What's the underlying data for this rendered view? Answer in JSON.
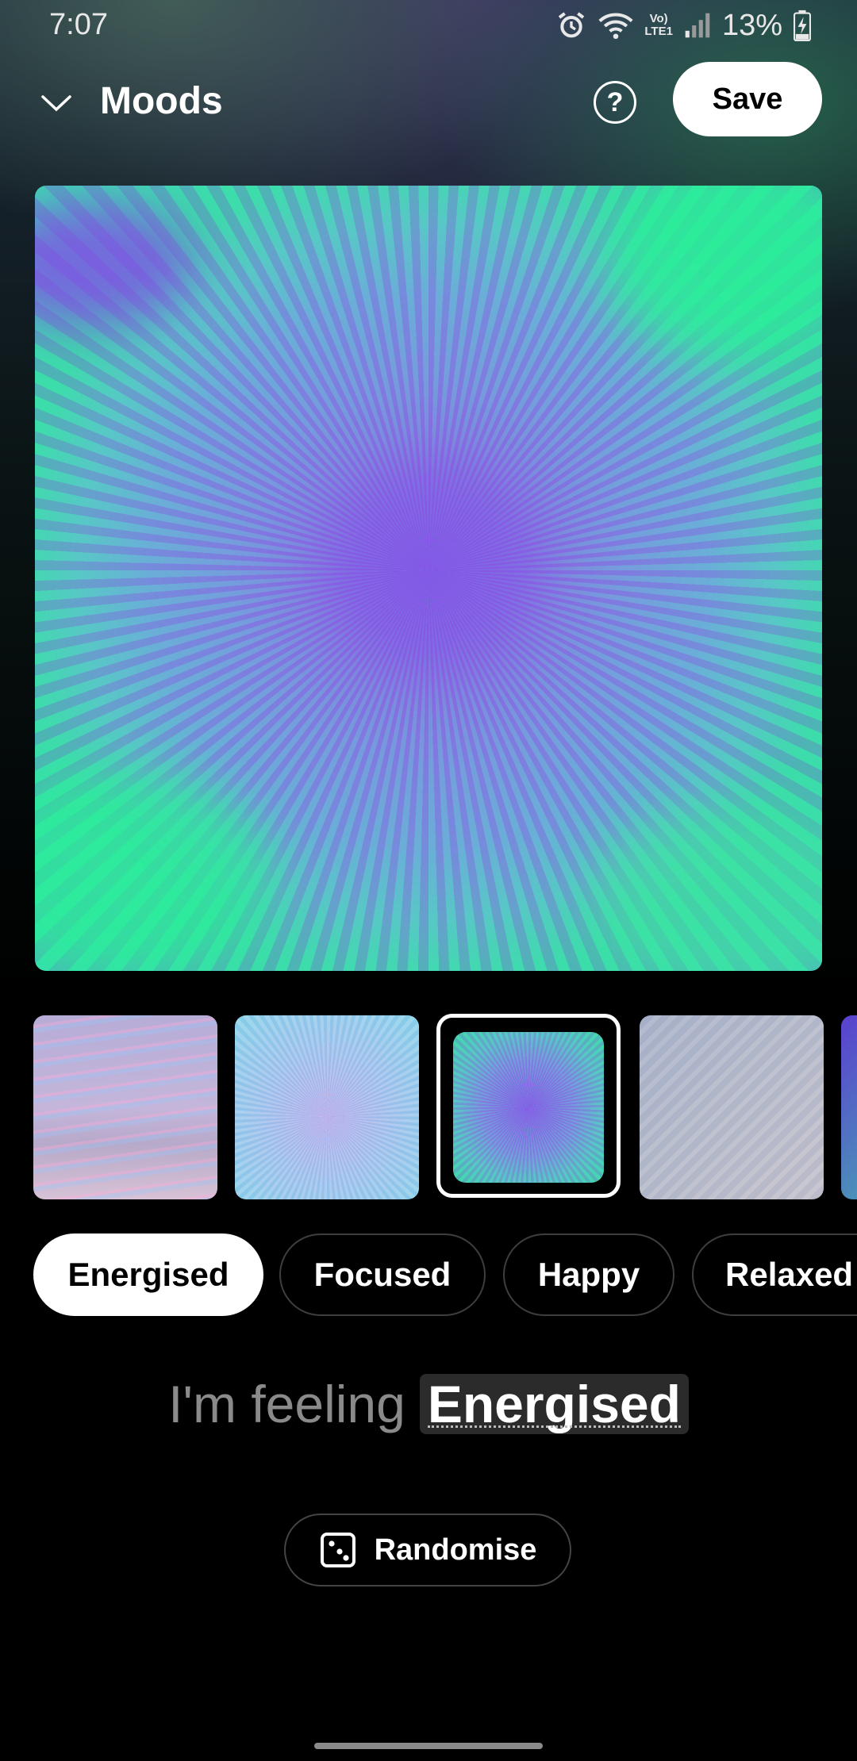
{
  "status_bar": {
    "time": "7:07",
    "network_label_top": "Vo)",
    "network_label_bottom": "LTE1",
    "battery": "13%"
  },
  "header": {
    "title": "Moods",
    "help_symbol": "?",
    "save_label": "Save"
  },
  "wallpaper_options": {
    "selected_index": 2,
    "count_visible": 5
  },
  "moods": {
    "items": [
      "Energised",
      "Focused",
      "Happy",
      "Relaxed"
    ],
    "selected": "Energised"
  },
  "feeling": {
    "prefix": "I'm feeling",
    "value": "Energised"
  },
  "randomise": {
    "label": "Randomise"
  },
  "colors": {
    "accent": "#ffffff",
    "background": "#000000",
    "chip_border": "#3e3e3e"
  }
}
